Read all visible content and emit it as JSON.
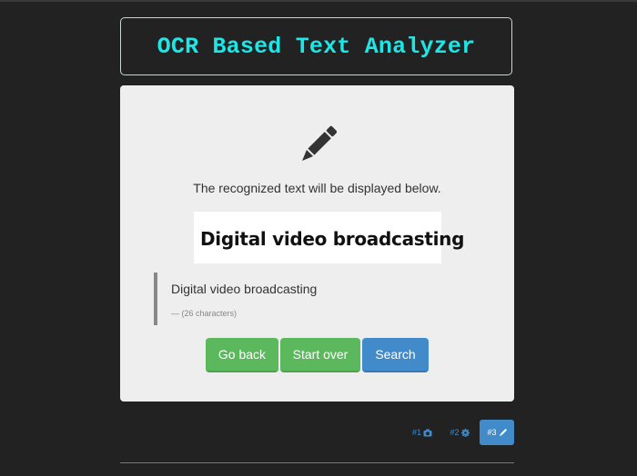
{
  "header": {
    "title": "OCR Based Text Analyzer"
  },
  "panel": {
    "icon": "pencil-icon",
    "info_text": "The recognized text will be displayed below.",
    "ocr_image_text": "Digital video broadcasting",
    "recognized_text": "Digital video broadcasting",
    "char_count_text": "— (26 characters)"
  },
  "buttons": {
    "go_back": "Go back",
    "start_over": "Start over",
    "search": "Search"
  },
  "steps": [
    {
      "label": "#1",
      "icon": "camera-icon",
      "active": false
    },
    {
      "label": "#2",
      "icon": "gear-icon",
      "active": false
    },
    {
      "label": "#3",
      "icon": "pencil-icon",
      "active": true
    }
  ],
  "colors": {
    "background": "#222222",
    "title": "#1fe6e6",
    "panel": "#eeeeee",
    "green_button": "#5cb85c",
    "blue_button": "#428bca"
  }
}
